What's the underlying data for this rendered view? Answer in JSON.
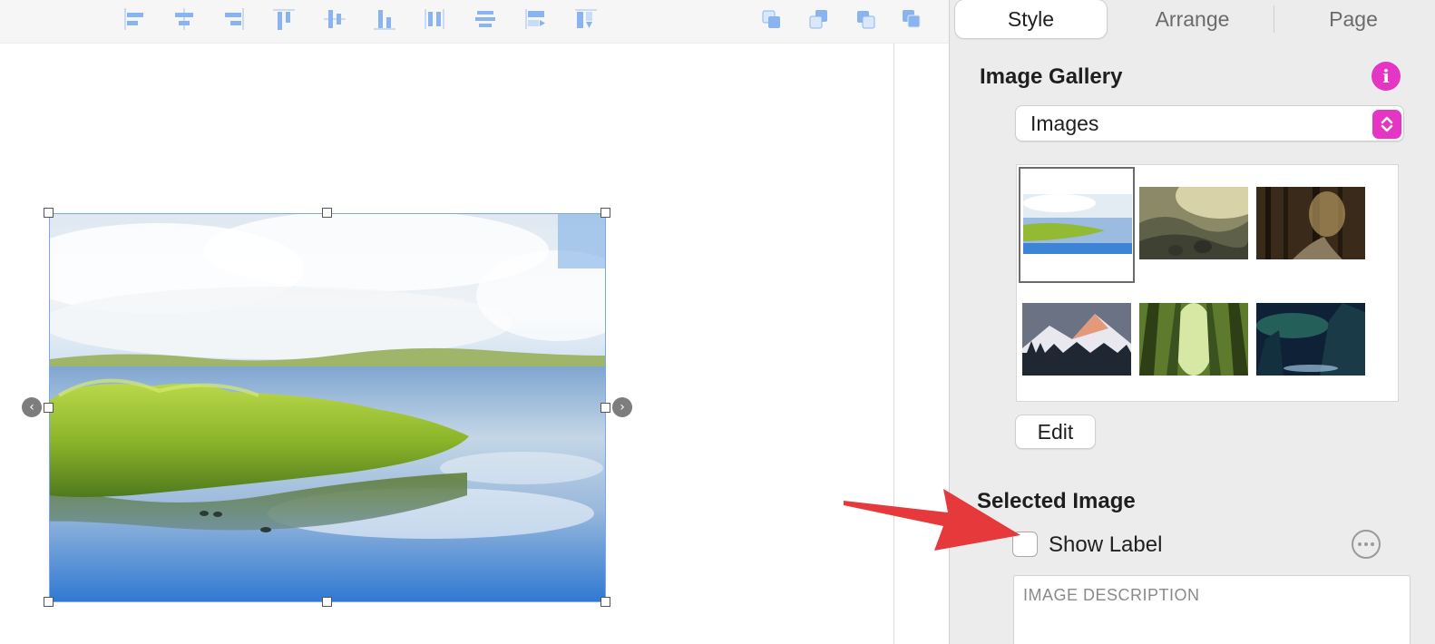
{
  "toolbar": {
    "align_buttons": [
      {
        "icon": "align-left-icon"
      },
      {
        "icon": "align-center-icon"
      },
      {
        "icon": "align-right-icon"
      },
      {
        "icon": "align-top-icon"
      },
      {
        "icon": "align-middle-icon"
      },
      {
        "icon": "align-bottom-icon"
      },
      {
        "icon": "distribute-horizontal-icon"
      },
      {
        "icon": "distribute-vertical-icon"
      },
      {
        "icon": "match-width-icon"
      },
      {
        "icon": "match-height-icon"
      }
    ],
    "arrange_buttons": [
      {
        "icon": "bring-to-front-icon"
      },
      {
        "icon": "send-to-back-icon"
      },
      {
        "icon": "bring-forward-icon"
      },
      {
        "icon": "send-backward-icon"
      }
    ],
    "icon_color": "#8ab4f0"
  },
  "inspector": {
    "tabs": [
      {
        "label": "Style",
        "active": true
      },
      {
        "label": "Arrange",
        "active": false
      },
      {
        "label": "Page",
        "active": false
      }
    ],
    "gallery_section": {
      "title": "Image Gallery",
      "info_icon": "info-icon",
      "select_value": "Images",
      "edit_label": "Edit",
      "thumbnails": [
        {
          "name": "lake-grass",
          "selected": true
        },
        {
          "name": "misty-mountains",
          "selected": false
        },
        {
          "name": "dark-forest-path",
          "selected": false
        },
        {
          "name": "snowy-peaks",
          "selected": false
        },
        {
          "name": "bamboo-forest",
          "selected": false
        },
        {
          "name": "aurora-night",
          "selected": false
        }
      ]
    },
    "selected_section": {
      "title": "Selected Image",
      "show_label": "Show Label",
      "show_label_checked": false,
      "description_placeholder": "IMAGE DESCRIPTION"
    }
  },
  "colors": {
    "accent": "#e535c4",
    "annotation_arrow": "#e5393b",
    "selection": "#7fa7e8"
  }
}
